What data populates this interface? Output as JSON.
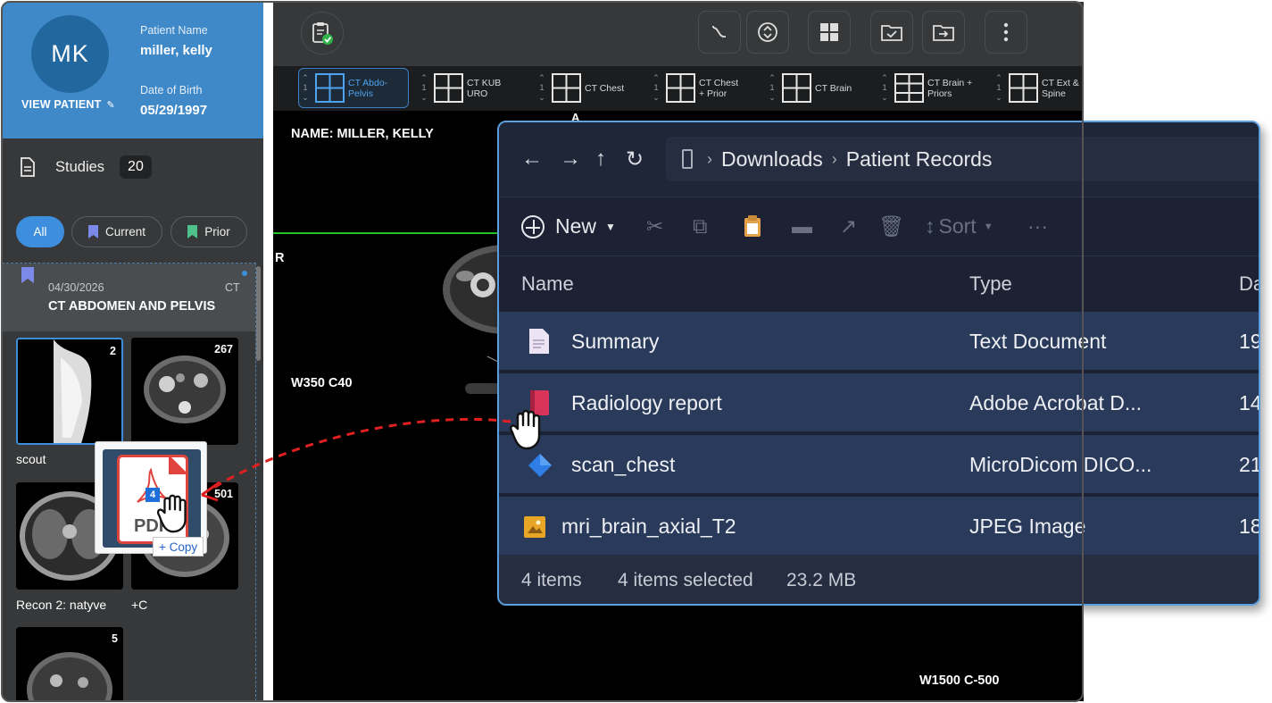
{
  "patient": {
    "initials": "MK",
    "view_patient": "VIEW PATIENT",
    "name_label": "Patient Name",
    "name": "miller, kelly",
    "dob_label": "Date of Birth",
    "dob": "05/29/1997"
  },
  "studies": {
    "label": "Studies",
    "count": "20",
    "filters": [
      "All",
      "Current",
      "Prior"
    ],
    "study": {
      "date": "04/30/2026",
      "modality": "CT",
      "name": "CT ABDOMEN AND PELVIS"
    },
    "thumbnails": [
      {
        "label": "scout",
        "count": "2"
      },
      {
        "label": "",
        "count": "267"
      },
      {
        "label": "Recon 2: natyve",
        "count": ""
      },
      {
        "label": "+C",
        "count": "501"
      },
      {
        "label": "",
        "count": "5"
      }
    ]
  },
  "drag": {
    "file_text": "PDF",
    "badge": "4",
    "copy_label": "+ Copy"
  },
  "viewer": {
    "series": [
      {
        "index": "1",
        "label": "CT Abdo-\nPelvis",
        "active": true
      },
      {
        "index": "1",
        "label": "CT KUB\nURO",
        "active": false
      },
      {
        "index": "1",
        "label": "CT Chest",
        "active": false
      },
      {
        "index": "1",
        "label": "CT Chest\n+ Prior",
        "active": false
      },
      {
        "index": "1",
        "label": "CT Brain",
        "active": false
      },
      {
        "index": "1",
        "label": "CT Brain +\nPriors",
        "active": false
      },
      {
        "index": "1",
        "label": "CT Ext &\nSpine",
        "active": false
      }
    ],
    "overlay": {
      "name": "NAME: MILLER, KELLY",
      "orientation_left": "R",
      "orientation_top": "A",
      "window_left": "W350 C40",
      "window_bottom": "W1500 C-500"
    }
  },
  "explorer": {
    "path": [
      "Downloads",
      "Patient Records"
    ],
    "commands": {
      "new": "New",
      "sort": "Sort",
      "more": "···"
    },
    "columns": {
      "name": "Name",
      "type": "Type",
      "date": "Da"
    },
    "files": [
      {
        "name": "Summary",
        "type": "Text Document",
        "date": "19",
        "icon": "text-document-icon"
      },
      {
        "name": "Radiology report",
        "type": "Adobe Acrobat D...",
        "date": "14",
        "icon": "pdf-document-icon"
      },
      {
        "name": "scan_chest",
        "type": "MicroDicom DICO...",
        "date": "21",
        "icon": "dicom-file-icon"
      },
      {
        "name": "mri_brain_axial_T2",
        "type": "JPEG Image",
        "date": "18",
        "icon": "jpeg-image-icon"
      }
    ],
    "status": {
      "items": "4 items",
      "selected": "4 items selected",
      "size": "23.2 MB"
    }
  },
  "colors": {
    "patient_card": "#3f89c9",
    "accent": "#3d8fdd",
    "explorer_bg": "#1c2233",
    "selection": "#2a3a5a",
    "drag_arrow": "#e02020"
  }
}
